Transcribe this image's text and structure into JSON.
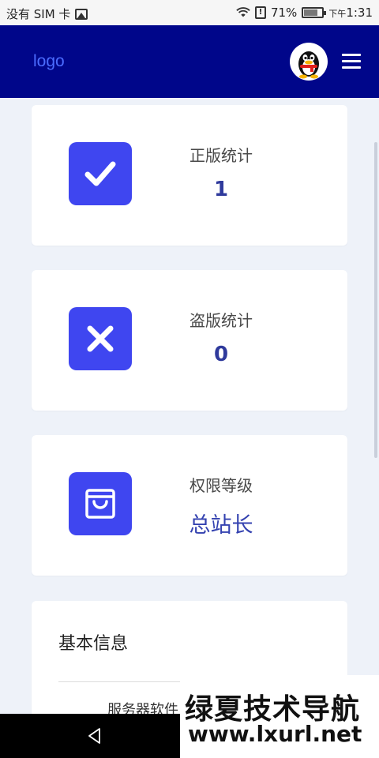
{
  "status_bar": {
    "carrier": "没有 SIM 卡",
    "battery_percent": "71%",
    "battery_level": 0.71,
    "time_prefix": "下午",
    "time": "1:31",
    "icons": [
      "image-icon",
      "wifi-icon",
      "alert-icon",
      "battery-icon"
    ]
  },
  "header": {
    "logo": "logo",
    "avatar": "qq-penguin-avatar",
    "menu_icon": "hamburger-menu-icon",
    "background": "#00068a"
  },
  "stats": [
    {
      "label": "正版统计",
      "value": "1",
      "icon": "checkmark-icon"
    },
    {
      "label": "盗版统计",
      "value": "0",
      "icon": "x-icon"
    },
    {
      "label": "权限等级",
      "value": "总站长",
      "icon": "shopping-bag-icon"
    }
  ],
  "info": {
    "title": "基本信息",
    "row_label": "服务器软件"
  },
  "watermark": {
    "line1": "绿夏技术导航",
    "line2": "www.lxurl.net"
  },
  "colors": {
    "accent": "#3f46f0",
    "value_text": "#2f3a9c",
    "logo_text": "#4b6cff"
  }
}
